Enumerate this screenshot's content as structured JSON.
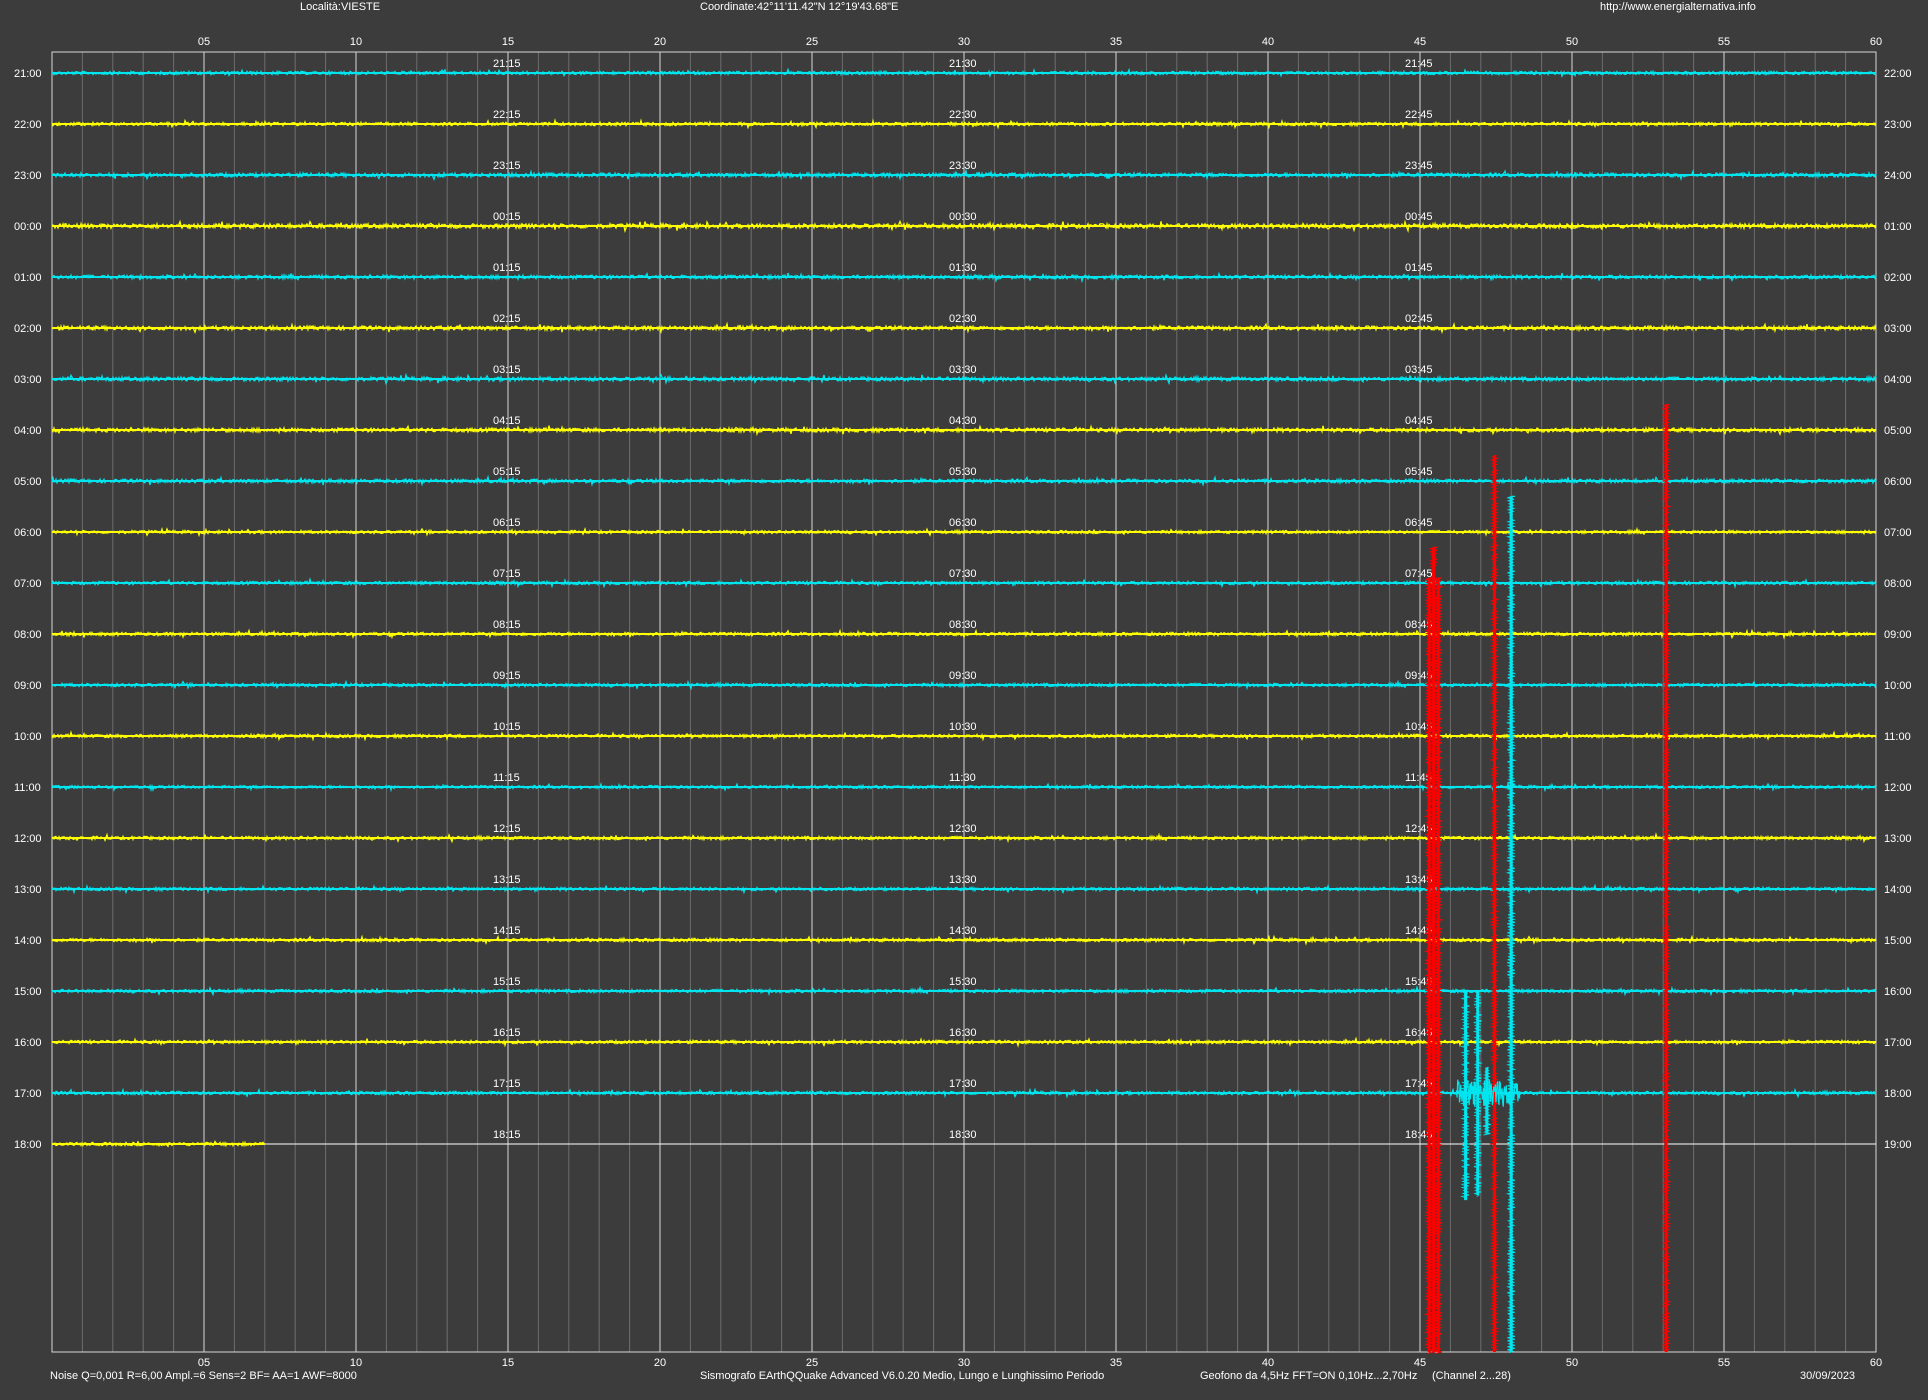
{
  "header": {
    "location": "Località:VIESTE",
    "coordinates": "Coordinate:42°11'11.42\"N  12°19'43.68\"E",
    "website": "http://www.energialternativa.info"
  },
  "footer": {
    "settings": "Noise Q=0,001 R=6,00 Ampl.=6 Sens=2 BF= AA=1 AWF=8000",
    "software": "Sismografo  EArthQQuake Advanced V6.0.20  Medio, Lungo e Lunghissimo Periodo",
    "sensor": "Geofono da 4,5Hz FFT=ON 0,10Hz...2,70Hz",
    "channel": "(Channel 2...28)",
    "date": "30/09/2023"
  },
  "colors": {
    "background": "#3c3c3c",
    "grid_major": "#d8d8d8",
    "grid_minor": "#6e6e6e",
    "trace_a": "#00e5ee",
    "trace_b": "#ffff00",
    "event": "#ff0000",
    "text": "#ffffff"
  },
  "chart_data": {
    "type": "line",
    "title": "",
    "xlabel": "",
    "ylabel": "",
    "x_unit": "minutes",
    "xlim": [
      0,
      60
    ],
    "x_ticks": [
      "05",
      "10",
      "15",
      "20",
      "25",
      "30",
      "35",
      "40",
      "45",
      "50",
      "55",
      "60"
    ],
    "rows_left_labels": [
      "21:00",
      "22:00",
      "23:00",
      "00:00",
      "01:00",
      "02:00",
      "03:00",
      "04:00",
      "05:00",
      "06:00",
      "07:00",
      "08:00",
      "09:00",
      "10:00",
      "11:00",
      "12:00",
      "13:00",
      "14:00",
      "15:00",
      "16:00",
      "17:00",
      "18:00"
    ],
    "rows_right_labels": [
      "22:00",
      "23:00",
      "24:00",
      "01:00",
      "02:00",
      "03:00",
      "04:00",
      "05:00",
      "06:00",
      "07:00",
      "08:00",
      "09:00",
      "10:00",
      "11:00",
      "12:00",
      "13:00",
      "14:00",
      "15:00",
      "16:00",
      "17:00",
      "18:00",
      "19:00"
    ],
    "quarter_labels": [
      [
        "21:15",
        "21:30",
        "21:45"
      ],
      [
        "22:15",
        "22:30",
        "22:45"
      ],
      [
        "23:15",
        "23:30",
        "23:45"
      ],
      [
        "00:15",
        "00:30",
        "00:45"
      ],
      [
        "01:15",
        "01:30",
        "01:45"
      ],
      [
        "02:15",
        "02:30",
        "02:45"
      ],
      [
        "03:15",
        "03:30",
        "03:45"
      ],
      [
        "04:15",
        "04:30",
        "04:45"
      ],
      [
        "05:15",
        "05:30",
        "05:45"
      ],
      [
        "06:15",
        "06:30",
        "06:45"
      ],
      [
        "07:15",
        "07:30",
        "07:45"
      ],
      [
        "08:15",
        "08:30",
        "08:45"
      ],
      [
        "09:15",
        "09:30",
        "09:45"
      ],
      [
        "10:15",
        "10:30",
        "10:45"
      ],
      [
        "11:15",
        "11:30",
        "11:45"
      ],
      [
        "12:15",
        "12:30",
        "12:45"
      ],
      [
        "13:15",
        "13:30",
        "13:45"
      ],
      [
        "14:15",
        "14:30",
        "14:45"
      ],
      [
        "15:15",
        "15:30",
        "15:45"
      ],
      [
        "16:15",
        "16:30",
        "16:45"
      ],
      [
        "17:15",
        "17:30",
        "17:45"
      ],
      [
        "18:15",
        "18:30",
        "18:45"
      ]
    ],
    "last_row_end_minute": 7.0,
    "noise_levels": [
      0.3,
      0.3,
      0.45,
      0.55,
      0.4,
      0.45,
      0.45,
      0.45,
      0.4,
      0.25,
      0.3,
      0.3,
      0.3,
      0.3,
      0.25,
      0.3,
      0.3,
      0.3,
      0.3,
      0.3,
      0.3,
      0.3
    ],
    "events": [
      {
        "minute": 45.3,
        "color": "red",
        "top_row": 9.9,
        "bottom_row": 25.5
      },
      {
        "minute": 45.45,
        "color": "red",
        "top_row": 9.3,
        "bottom_row": 25.5
      },
      {
        "minute": 45.6,
        "color": "red",
        "top_row": 9.9,
        "bottom_row": 25.4
      },
      {
        "minute": 47.45,
        "color": "red",
        "top_row": 7.5,
        "bottom_row": 25.4
      },
      {
        "minute": 48.0,
        "color": "cyan",
        "top_row": 8.3,
        "bottom_row": 25.5
      },
      {
        "minute": 53.1,
        "color": "red",
        "top_row": 6.5,
        "bottom_row": 25.5
      },
      {
        "minute": 46.5,
        "color": "cyan",
        "top_row": 18.0,
        "bottom_row": 22.1
      },
      {
        "minute": 46.9,
        "color": "cyan",
        "top_row": 18.0,
        "bottom_row": 22.0
      },
      {
        "minute": 47.2,
        "color": "cyan",
        "top_row": 19.5,
        "bottom_row": 20.8
      }
    ]
  }
}
